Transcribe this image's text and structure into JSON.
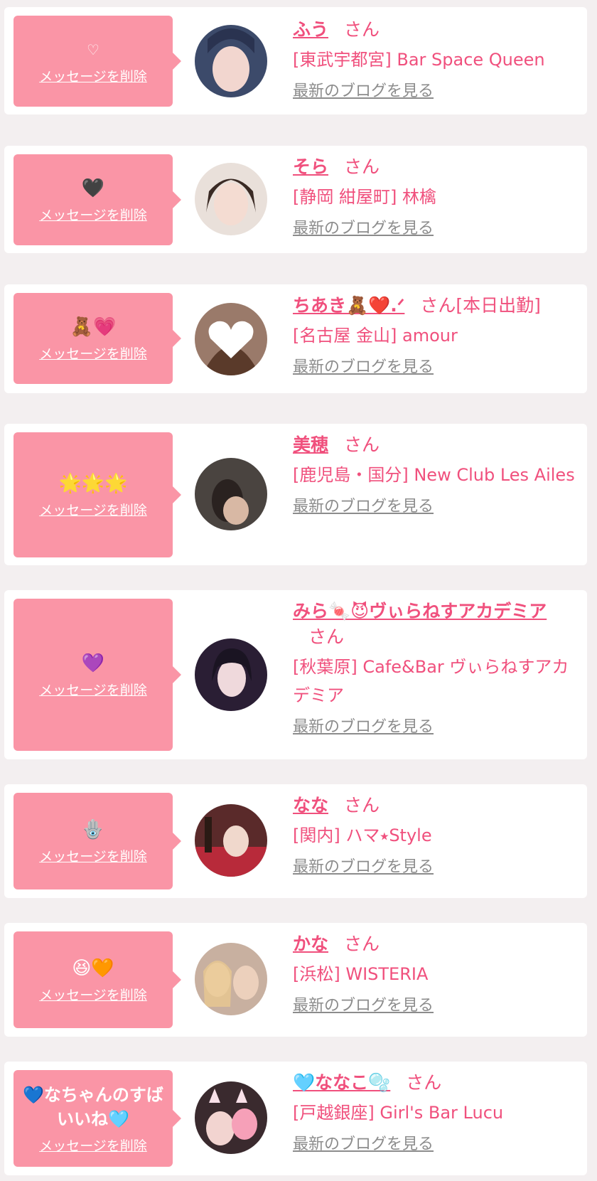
{
  "delete_label": "メッセージを削除",
  "honorific": "さん",
  "blog_label": "最新のブログを見る",
  "colors": {
    "bubble": "#fa95a6",
    "name": "#f0507d",
    "blog_link": "#8c8c8c",
    "background": "#f3eff0"
  },
  "messages": [
    {
      "reaction": "♡",
      "name": "ふう",
      "extra": "",
      "shop": "[東武宇都宮] Bar Space Queen"
    },
    {
      "reaction": "🖤",
      "name": "そら",
      "extra": "",
      "shop": "[静岡 紺屋町] 林檎"
    },
    {
      "reaction": "🧸💗",
      "name": "ちあき🧸❤️.ᐟ",
      "extra": "[本日出勤]",
      "shop": "[名古屋 金山] amour"
    },
    {
      "reaction": "🌟🌟🌟",
      "name": "美穂",
      "extra": "",
      "shop": "[鹿児島・国分] New Club Les Ailes"
    },
    {
      "reaction": "💜",
      "name": "みら🍬😈ヴぃらねすアカデミア",
      "extra": "",
      "shop": "[秋葉原] Cafe&Bar ヴぃらねすアカデミア"
    },
    {
      "reaction": "🪬",
      "name": "なな",
      "extra": "",
      "shop": "[関内] ハマ⭑Style"
    },
    {
      "reaction": "😆🧡",
      "name": "かな",
      "extra": "",
      "shop": "[浜松] WISTERIA"
    },
    {
      "reaction": "💙なちゃんのすばいいね🩵",
      "name": "🩵ななこ🫧",
      "extra": "",
      "shop": "[戸越銀座] Girl's Bar Lucu"
    }
  ]
}
